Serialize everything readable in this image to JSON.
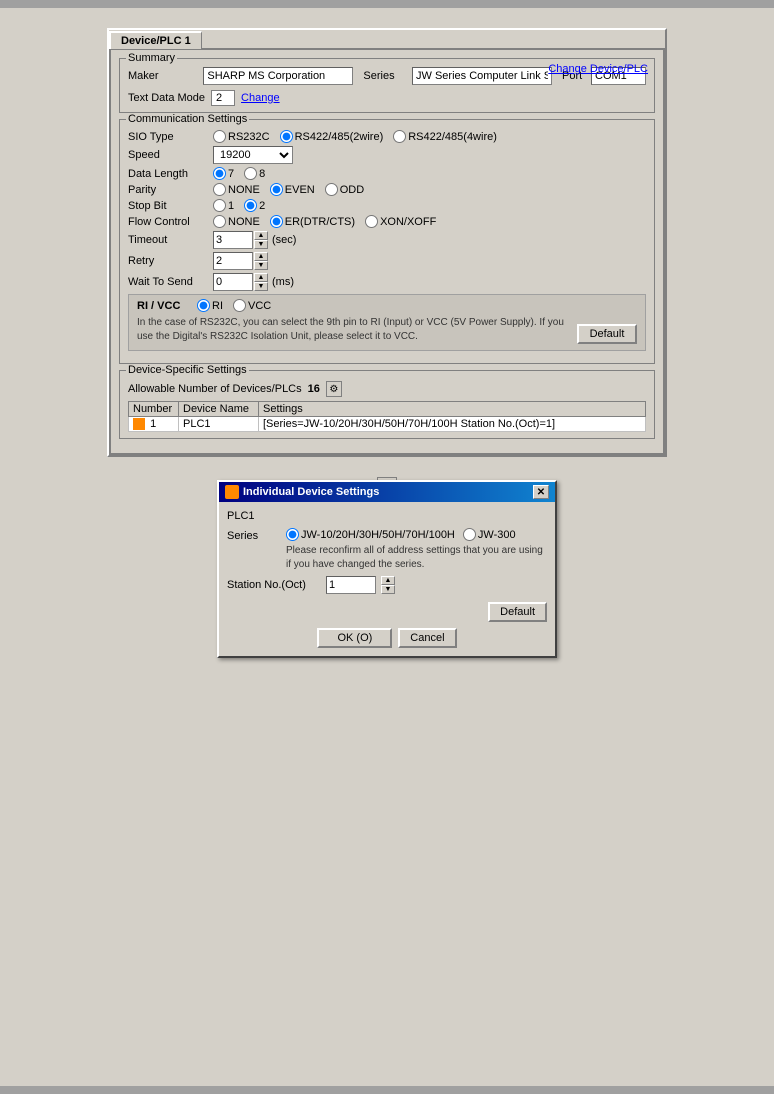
{
  "topBar": {},
  "tab": {
    "label": "Device/PLC 1"
  },
  "summary": {
    "sectionLabel": "Summary",
    "changeDeviceLabel": "Change Device/PLC",
    "makerLabel": "Maker",
    "makerValue": "SHARP MS Corporation",
    "seriesLabel": "Series",
    "seriesValue": "JW Series Computer Link SIO",
    "portLabel": "Port",
    "portValue": "COM1",
    "textDataModeLabel": "Text Data Mode",
    "textDataModeValue": "2",
    "changeLabel": "Change"
  },
  "communication": {
    "sectionLabel": "Communication Settings",
    "sioTypeLabel": "SIO Type",
    "rs232c": "RS232C",
    "rs422_2wire": "RS422/485(2wire)",
    "rs422_4wire": "RS422/485(4wire)",
    "speedLabel": "Speed",
    "speedValue": "19200",
    "dataLengthLabel": "Data Length",
    "dl7": "7",
    "dl8": "8",
    "parityLabel": "Parity",
    "parityNone": "NONE",
    "parityEven": "EVEN",
    "parityOdd": "ODD",
    "stopBitLabel": "Stop Bit",
    "sb1": "1",
    "sb2": "2",
    "flowControlLabel": "Flow Control",
    "fcNone": "NONE",
    "fcEr": "ER(DTR/CTS)",
    "fcXon": "XON/XOFF",
    "timeoutLabel": "Timeout",
    "timeoutValue": "3",
    "timeoutUnit": "(sec)",
    "retryLabel": "Retry",
    "retryValue": "2",
    "waitToSendLabel": "Wait To Send",
    "waitToSendValue": "0",
    "waitToSendUnit": "(ms)"
  },
  "riVcc": {
    "label": "RI / VCC",
    "riOption": "RI",
    "vccOption": "VCC",
    "description": "In the case of RS232C, you can select the 9th pin to RI (Input) or VCC (5V Power Supply). If you use the Digital's RS232C Isolation Unit, please select it to VCC.",
    "defaultBtn": "Default"
  },
  "deviceSpecific": {
    "sectionLabel": "Device-Specific Settings",
    "allowableLabel": "Allowable Number of Devices/PLCs",
    "allowableCount": "16",
    "numberHeader": "Number",
    "deviceNameHeader": "Device Name",
    "settingsHeader": "Settings",
    "rows": [
      {
        "number": "1",
        "deviceName": "PLC1",
        "settings": "[Series=JW-10/20H/30H/50H/70H/100H Station No.(Oct)=1]"
      }
    ]
  },
  "individualDialog": {
    "title": "Individual Device Settings",
    "plcName": "PLC1",
    "seriesLabel": "Series",
    "series1": "JW-10/20H/30H/50H/70H/100H",
    "series2": "JW-300",
    "note": "Please reconfirm all of address settings that you are using if you have changed the series.",
    "stationLabel": "Station No.(Oct)",
    "stationValue": "1",
    "defaultBtn": "Default",
    "okBtn": "OK (O)",
    "cancelBtn": "Cancel"
  }
}
